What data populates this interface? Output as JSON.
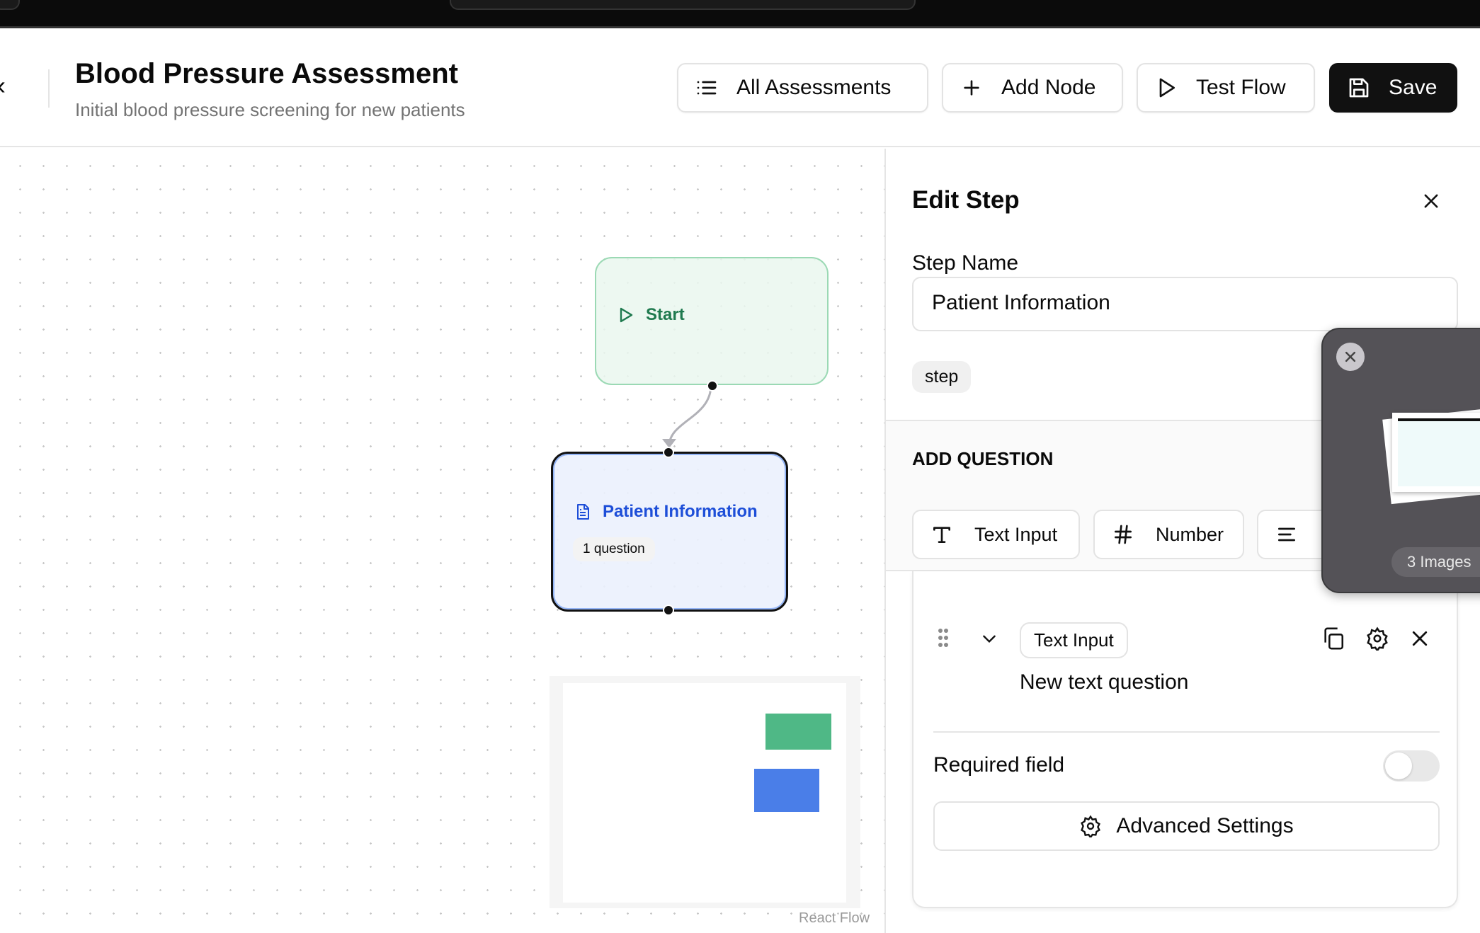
{
  "header": {
    "title": "Blood Pressure Assessment",
    "subtitle": "Initial blood pressure screening for new patients",
    "back_glyph": "‹",
    "buttons": {
      "all": "All Assessments",
      "add": "Add Node",
      "test": "Test Flow",
      "save": "Save"
    }
  },
  "canvas": {
    "start_label": "Start",
    "step_label": "Patient Information",
    "step_count": "1 question",
    "attribution": "React Flow",
    "colors": {
      "start_bg": "#eaf7ef",
      "start_border": "#9bd9b4",
      "start_text": "#1f7a4f",
      "step_bg": "#ebf1fd",
      "step_text": "#1d4ed8",
      "mini_start": "#4fb886",
      "mini_step": "#4a7ee8"
    }
  },
  "panel": {
    "title": "Edit Step",
    "step_name_label": "Step Name",
    "step_name_value": "Patient Information",
    "type_chip": "step",
    "add_question_label": "ADD QUESTION",
    "question_types": [
      "Text Input",
      "Number"
    ],
    "question": {
      "type": "Text Input",
      "text": "New text question",
      "required_label": "Required field",
      "required": false,
      "advanced": "Advanced Settings"
    }
  },
  "overlay": {
    "count_label": "3 Images"
  }
}
